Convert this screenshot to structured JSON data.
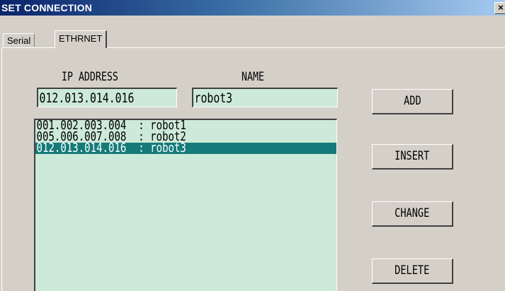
{
  "window": {
    "title": "SET CONNECTION",
    "close_glyph": "×",
    "close_icon": "close-icon"
  },
  "tabs": [
    {
      "label": "Serial",
      "active": false
    },
    {
      "label": "ETHRNET",
      "active": true
    }
  ],
  "form": {
    "ip_label": "IP ADDRESS",
    "name_label": "NAME",
    "ip_value": "012.013.014.016",
    "name_value": "robot3"
  },
  "list": {
    "items": [
      {
        "ip": "001.002.003.004",
        "name": "robot1",
        "text": "001.002.003.004  : robot1"
      },
      {
        "ip": "005.006.007.008",
        "name": "robot2",
        "text": "005.006.007.008  : robot2"
      },
      {
        "ip": "012.013.014.016",
        "name": "robot3",
        "text": "012.013.014.016  : robot3"
      }
    ],
    "selected_index": 2
  },
  "buttons": {
    "add": "ADD",
    "insert": "INSERT",
    "change": "CHANGE",
    "delete": "DELETE"
  },
  "colors": {
    "title_start": "#0a246a",
    "title_end": "#a6caf0",
    "field_bg": "#cde9d9",
    "selection": "#157a7a",
    "face": "#d4d0c8"
  }
}
